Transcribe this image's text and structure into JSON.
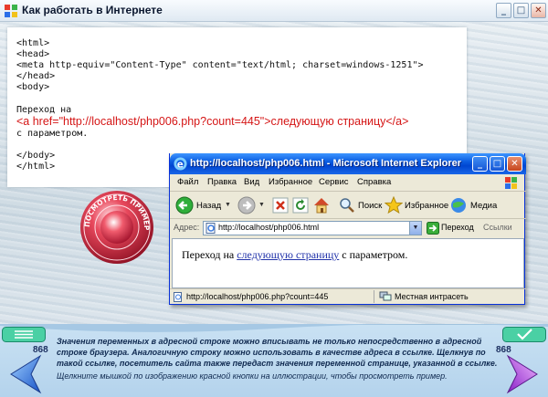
{
  "window": {
    "title": "Как работать в Интернете",
    "minimize_glyph": "_",
    "maximize_glyph": "□",
    "close_glyph": "✕"
  },
  "code": {
    "lines_top": [
      "<html>",
      "<head>",
      "<meta http-equiv=\"Content-Type\" content=\"text/html; charset=windows-1251\">",
      "</head>",
      "<body>"
    ],
    "text_before": "Переход на",
    "link_line": "<a href=\"http://localhost/php006.php?count=445\">следующую страницу</a>",
    "text_after": "с параметром.",
    "lines_bottom": [
      "</body>",
      "</html>"
    ]
  },
  "stamp": {
    "label": "ПОСМОТРЕТЬ ПРИМЕР"
  },
  "ie": {
    "title": "http://localhost/php006.html - Microsoft Internet Explorer",
    "menu": [
      "Файл",
      "Правка",
      "Вид",
      "Избранное",
      "Сервис",
      "Справка"
    ],
    "toolbar": {
      "back": "Назад",
      "search": "Поиск",
      "favorites": "Избранное",
      "media": "Медиа"
    },
    "address_label": "Адрес:",
    "address_value": "http://localhost/php006.html",
    "go_label": "Переход",
    "links_label": "Ссылки",
    "content": {
      "before": "Переход на ",
      "link": "следующую страницу",
      "after": " с параметром."
    },
    "status_url": "http://localhost/php006.php?count=445",
    "status_zone": "Местная интрасеть"
  },
  "bottom": {
    "text": "Значения переменных в адресной строке можно вписывать не только непосредственно в адресной строке браузера. Аналогичную строку можно использовать в качестве адреса в ссылке. Щелкнув по такой ссылке, посетитель сайта также передаст значения переменной странице, указанной в ссылке.",
    "hint": "Щелкните мышкой по изображению красной кнопки на иллюстрации, чтобы просмотреть пример.",
    "page_left": "868",
    "page_right": "868"
  }
}
